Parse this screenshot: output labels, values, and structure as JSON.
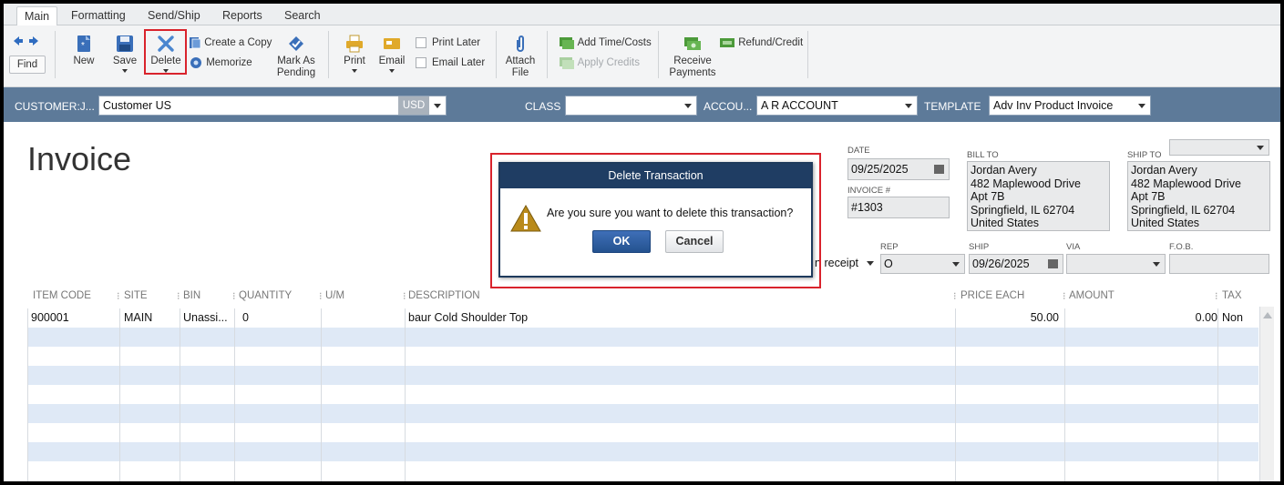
{
  "tabs": [
    "Main",
    "Formatting",
    "Send/Ship",
    "Reports",
    "Search"
  ],
  "toolbar": {
    "find": "Find",
    "new": "New",
    "save": "Save",
    "delete": "Delete",
    "create_copy": "Create a Copy",
    "memorize": "Memorize",
    "mark_as_pending_1": "Mark As",
    "mark_as_pending_2": "Pending",
    "print": "Print",
    "email": "Email",
    "print_later": "Print Later",
    "email_later": "Email Later",
    "attach_file_1": "Attach",
    "attach_file_2": "File",
    "add_time_costs": "Add Time/Costs",
    "apply_credits": "Apply Credits",
    "receive_payments_1": "Receive",
    "receive_payments_2": "Payments",
    "refund_credit": "Refund/Credit"
  },
  "customer_bar": {
    "customer_label": "CUSTOMER:J...",
    "customer_value": "Customer US",
    "currency": "USD",
    "class_label": "CLASS",
    "class_value": "",
    "account_label": "ACCOU...",
    "account_value": "A R ACCOUNT",
    "template_label": "TEMPLATE",
    "template_value": "Adv Inv Product Invoice"
  },
  "invoice": {
    "title": "Invoice",
    "date_label": "DATE",
    "date": "09/25/2025",
    "invoice_num_label": "INVOICE #",
    "invoice_num": "#1303",
    "bill_to_label": "BILL TO",
    "bill_to": [
      "Jordan Avery",
      "482 Maplewood Drive",
      "Apt 7B",
      "Springfield, IL 62704",
      "United States"
    ],
    "ship_to_label": "SHIP TO",
    "ship_to": [
      "Jordan Avery",
      "482 Maplewood Drive",
      "Apt 7B",
      "Springfield, IL 62704",
      "United States"
    ],
    "terms_partial": "n receipt",
    "rep_label": "REP",
    "rep": "O",
    "ship_label": "SHIP",
    "ship_date": "09/26/2025",
    "via_label": "VIA",
    "via": "",
    "fob_label": "F.O.B.",
    "fob": ""
  },
  "grid": {
    "headers": [
      "ITEM CODE",
      "SITE",
      "BIN",
      "QUANTITY",
      "U/M",
      "DESCRIPTION",
      "PRICE EACH",
      "AMOUNT",
      "TAX"
    ],
    "rows": [
      {
        "item_code": "900001",
        "site": "MAIN",
        "bin": "Unassi...",
        "quantity": "0",
        "um": "",
        "description": "baur Cold Shoulder Top",
        "price_each": "50.00",
        "amount": "0.00",
        "tax": "Non"
      }
    ]
  },
  "dialog": {
    "title": "Delete Transaction",
    "message": "Are you sure you want to delete this transaction?",
    "ok": "OK",
    "cancel": "Cancel"
  },
  "colors": {
    "accent_bar": "#5d7a99",
    "dialog_title": "#1f3d63",
    "highlight": "#d9232c",
    "row_alt": "#dfe9f6"
  }
}
